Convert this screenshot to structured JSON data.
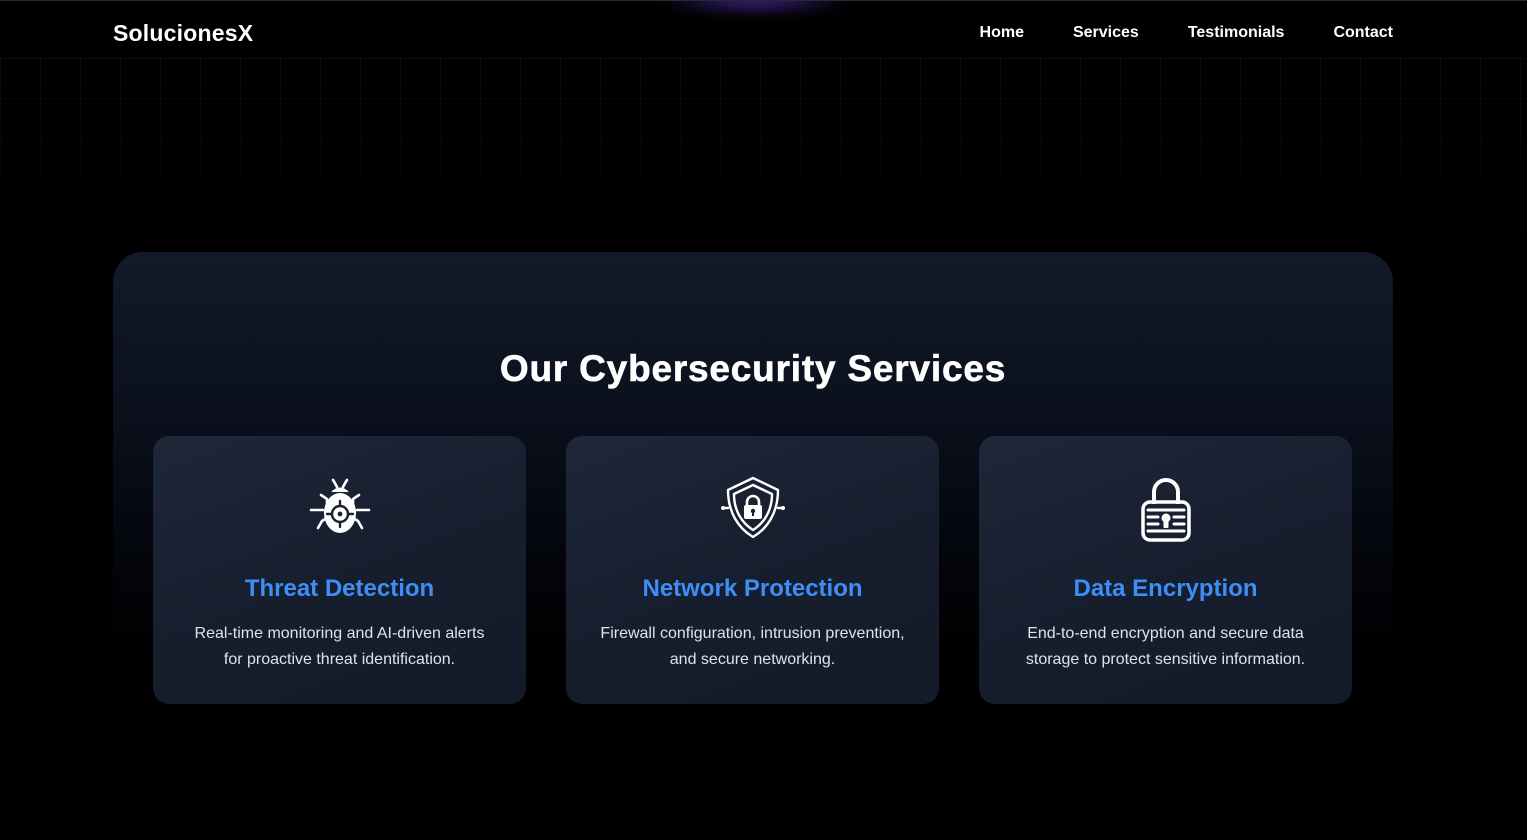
{
  "brand": {
    "name": "SolucionesX"
  },
  "nav": {
    "items": [
      {
        "label": "Home"
      },
      {
        "label": "Services"
      },
      {
        "label": "Testimonials"
      },
      {
        "label": "Contact"
      }
    ]
  },
  "services": {
    "title": "Our Cybersecurity Services",
    "cards": [
      {
        "icon": "bug-target-icon",
        "title": "Threat Detection",
        "description": "Real-time monitoring and AI-driven alerts for proactive threat identification."
      },
      {
        "icon": "shield-lock-icon",
        "title": "Network Protection",
        "description": "Firewall configuration, intrusion prevention, and secure networking."
      },
      {
        "icon": "padlock-icon",
        "title": "Data Encryption",
        "description": "End-to-end encryption and secure data storage to protect sensitive information."
      }
    ]
  },
  "colors": {
    "background": "#000000",
    "panel": "#121a2a",
    "card": "#1a2232",
    "accent": "#3d8ef5",
    "text": "#ffffff"
  }
}
